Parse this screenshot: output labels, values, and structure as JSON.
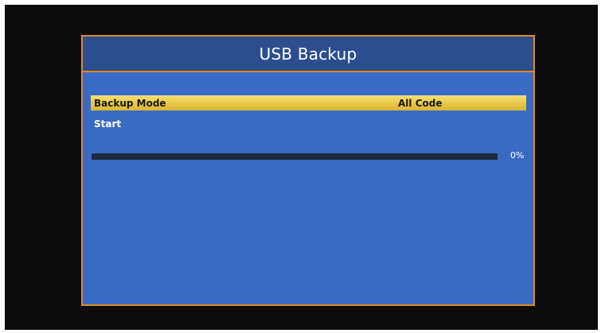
{
  "dialog": {
    "title": "USB Backup"
  },
  "menu": {
    "items": [
      {
        "label": "Backup Mode",
        "value": "All Code",
        "selected": true
      },
      {
        "label": "Start",
        "value": "",
        "selected": false
      }
    ]
  },
  "progress": {
    "fraction": 0.0,
    "label": "0%"
  },
  "colors": {
    "dialog_bg": "#3a6bc4",
    "title_bg": "#2b4f8e",
    "border": "#e08a1e",
    "highlight": "#e9c94a",
    "progress_track": "#1e2a3c",
    "screen_bg": "#0c0c0c"
  }
}
